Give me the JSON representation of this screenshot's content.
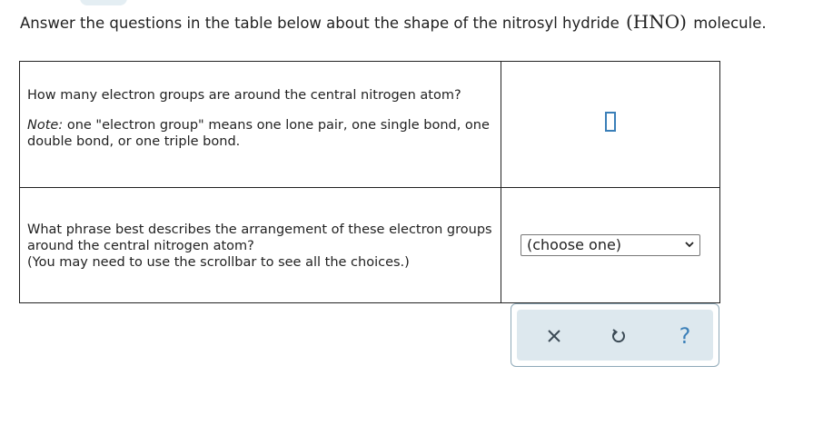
{
  "question": {
    "prefix": "Answer the questions in the table below about the shape of the nitrosyl hydride ",
    "formula": "(HNO)",
    "suffix": " molecule."
  },
  "rows": [
    {
      "prompt": "How many electron groups are around the central nitrogen atom?",
      "note_label": "Note:",
      "note_text": " one \"electron group\" means one lone pair, one single bond, one double bond, or one triple bond.",
      "answer_value": ""
    },
    {
      "prompt": "What phrase best describes the arrangement of these electron groups around the central nitrogen atom?",
      "prompt_line3": "(You may need to use the scrollbar to see all the choices.)",
      "select_value": "(choose one)"
    }
  ],
  "toolbar": {
    "clear_icon": "close-icon",
    "undo_icon": "undo-icon",
    "help_label": "?"
  },
  "colors": {
    "accent": "#3a7fb8",
    "toolbar_bg": "#dde8ee",
    "toolbar_border": "#8fa9b8"
  }
}
